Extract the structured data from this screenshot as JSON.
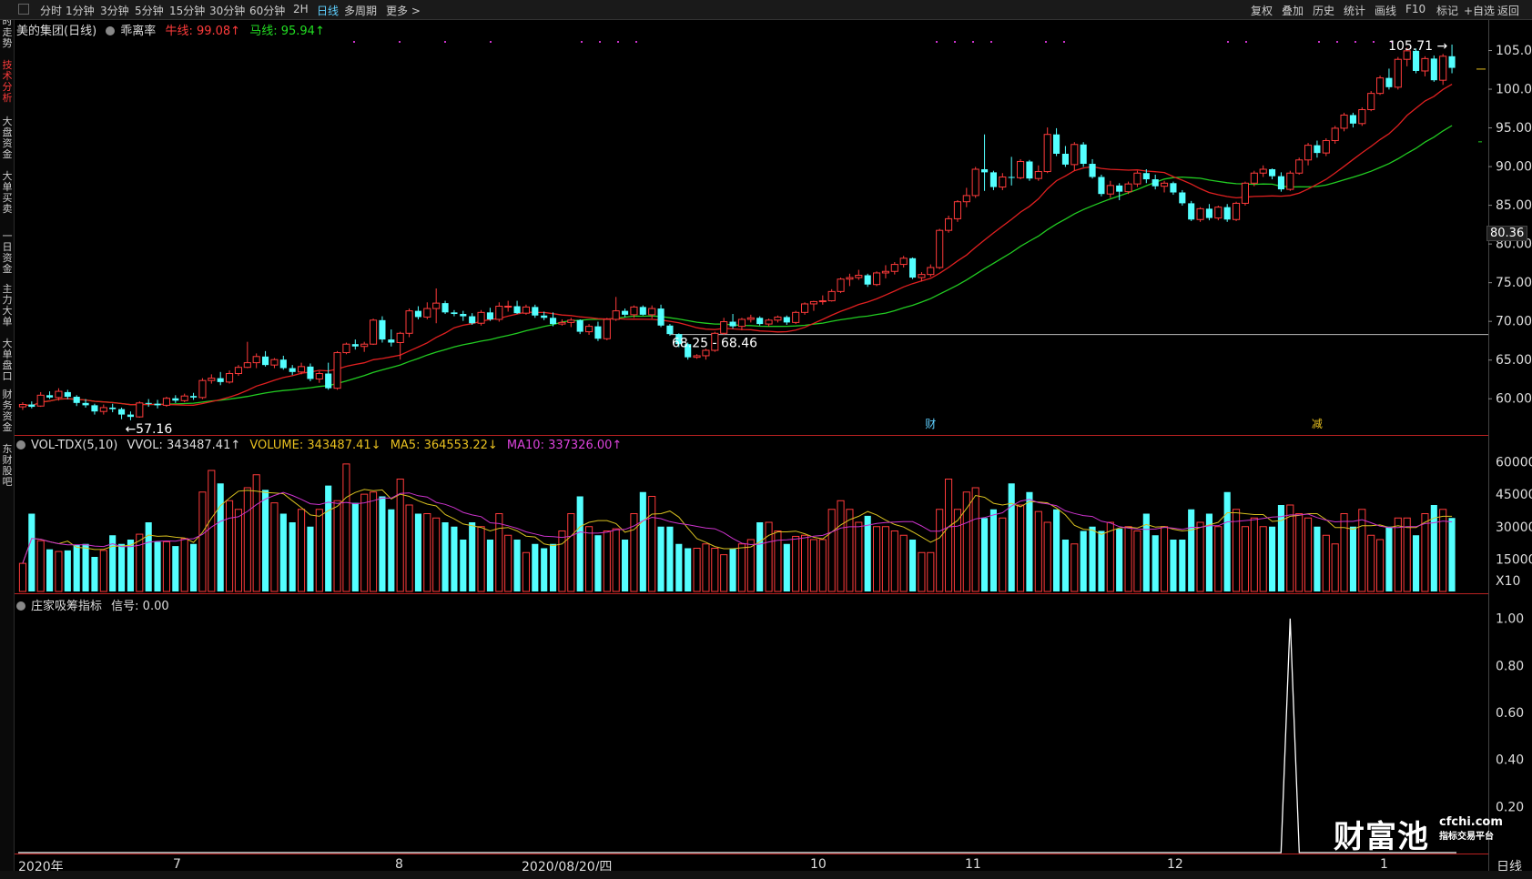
{
  "toolbar": {
    "left": [
      "分时",
      "1分钟",
      "3分钟",
      "5分钟",
      "15分钟",
      "30分钟",
      "60分钟",
      "2H",
      "日线",
      "多周期",
      "更多 >"
    ],
    "active": "日线",
    "right": [
      "复权",
      "叠加",
      "历史",
      "统计",
      "画线",
      "F10",
      "标记",
      "+自选",
      "返回"
    ]
  },
  "sidebar": [
    "分时走势",
    "技术分析",
    "大盘资金",
    "大单买卖",
    "一日资金",
    "主力大单",
    "大单盘口",
    "财务资金",
    "东财股吧"
  ],
  "sidebar_active": "技术分析",
  "price_header": {
    "stock": "美的集团(日线)",
    "indicator": "乖离率",
    "bull_label": "牛线: 99.08↑",
    "horse_label": "马线: 95.94↑"
  },
  "vol_header": {
    "name": "VOL-TDX(5,10)",
    "vvol": "VVOL: 343487.41↑",
    "volume": "VOLUME: 343487.41↓",
    "ma5": "MA5: 364553.22↓",
    "ma10": "MA10: 337326.00↑"
  },
  "sig_header": {
    "name": "庄家吸筹指标",
    "signal": "信号: 0.00"
  },
  "annotations": {
    "high": "105.71",
    "low": "57.16",
    "gap": "68.25 - 68.46",
    "marker_cai": "财",
    "marker_jian": "减",
    "current_price": "80.36",
    "vol_unit": "X10"
  },
  "dates": [
    "2020年",
    "7",
    "8",
    "2020/08/20/四",
    "10",
    "11",
    "12",
    "1"
  ],
  "period_label": "日线",
  "watermark": {
    "brand": "财富池",
    "site": "cfchi.com",
    "tagline": "指标交易平台"
  },
  "colors": {
    "up": "#ff3b3b",
    "down": "#54ffff",
    "ma_red": "#e02020",
    "ma_green": "#22cc22",
    "ma5": "#d8c020",
    "ma10": "#cc33cc"
  },
  "chart_data": [
    {
      "type": "candlestick",
      "title": "美的集团(日线)",
      "y_ticks": [
        60,
        65,
        70,
        75,
        80,
        85,
        90,
        95,
        100,
        105
      ],
      "ylim": [
        55.5,
        107
      ],
      "series_ohlc": [
        [
          58.9,
          59.5,
          58.5,
          59.2
        ],
        [
          59.2,
          59.6,
          58.7,
          58.9
        ],
        [
          59.0,
          60.8,
          58.9,
          60.4
        ],
        [
          60.4,
          60.9,
          59.9,
          60.1
        ],
        [
          60.1,
          61.3,
          59.7,
          60.9
        ],
        [
          60.8,
          61.1,
          59.9,
          60.2
        ],
        [
          60.2,
          60.4,
          59.0,
          59.4
        ],
        [
          59.4,
          59.9,
          58.8,
          59.1
        ],
        [
          59.1,
          59.3,
          57.9,
          58.3
        ],
        [
          58.3,
          59.2,
          57.9,
          58.8
        ],
        [
          58.8,
          59.3,
          58.2,
          58.6
        ],
        [
          58.6,
          58.8,
          57.3,
          57.9
        ],
        [
          57.9,
          58.3,
          57.16,
          57.6
        ],
        [
          57.6,
          59.6,
          57.5,
          59.4
        ],
        [
          59.4,
          59.9,
          58.9,
          59.3
        ],
        [
          59.3,
          59.8,
          58.7,
          59.1
        ],
        [
          59.1,
          60.2,
          58.9,
          60.0
        ],
        [
          60.0,
          60.4,
          59.4,
          59.7
        ],
        [
          59.7,
          60.6,
          59.5,
          60.3
        ],
        [
          60.3,
          60.7,
          59.8,
          60.1
        ],
        [
          60.1,
          62.6,
          59.9,
          62.3
        ],
        [
          62.3,
          63.1,
          61.9,
          62.6
        ],
        [
          62.6,
          63.4,
          61.7,
          62.1
        ],
        [
          62.1,
          63.6,
          61.9,
          63.2
        ],
        [
          63.2,
          64.3,
          62.9,
          64.0
        ],
        [
          64.0,
          67.3,
          63.9,
          64.6
        ],
        [
          64.6,
          65.8,
          63.9,
          65.4
        ],
        [
          65.4,
          66.1,
          64.1,
          64.3
        ],
        [
          64.3,
          65.2,
          63.9,
          65.0
        ],
        [
          65.0,
          65.5,
          63.7,
          63.9
        ],
        [
          63.9,
          64.3,
          63.0,
          63.4
        ],
        [
          63.4,
          64.6,
          63.1,
          64.1
        ],
        [
          64.1,
          64.5,
          62.2,
          62.5
        ],
        [
          62.5,
          63.5,
          62.0,
          63.2
        ],
        [
          63.2,
          64.6,
          61.1,
          61.3
        ],
        [
          61.3,
          66.1,
          61.1,
          65.9
        ],
        [
          65.9,
          67.2,
          65.7,
          67.0
        ],
        [
          67.0,
          67.6,
          66.3,
          66.7
        ],
        [
          66.7,
          67.3,
          66.0,
          67.0
        ],
        [
          67.0,
          70.3,
          66.9,
          70.1
        ],
        [
          70.1,
          70.6,
          67.2,
          67.6
        ],
        [
          67.6,
          68.9,
          66.7,
          67.2
        ],
        [
          67.2,
          68.6,
          65.0,
          68.4
        ],
        [
          68.4,
          71.6,
          67.9,
          71.3
        ],
        [
          71.3,
          71.9,
          70.2,
          70.5
        ],
        [
          70.5,
          72.4,
          70.2,
          71.6
        ],
        [
          71.6,
          74.2,
          69.7,
          72.3
        ],
        [
          72.3,
          72.6,
          70.9,
          71.1
        ],
        [
          71.1,
          71.4,
          70.6,
          70.9
        ],
        [
          70.9,
          71.3,
          70.0,
          70.6
        ],
        [
          70.6,
          71.0,
          69.5,
          69.7
        ],
        [
          69.7,
          71.4,
          69.4,
          71.1
        ],
        [
          71.1,
          71.7,
          70.0,
          70.2
        ],
        [
          70.2,
          72.4,
          69.9,
          71.9
        ],
        [
          71.9,
          72.6,
          71.2,
          71.9
        ],
        [
          71.9,
          72.6,
          70.9,
          71.0
        ],
        [
          71.0,
          72.1,
          70.8,
          71.8
        ],
        [
          71.8,
          72.1,
          70.4,
          70.7
        ],
        [
          70.7,
          71.2,
          70.1,
          70.4
        ],
        [
          70.4,
          71.1,
          69.3,
          69.6
        ],
        [
          69.6,
          70.2,
          69.4,
          69.8
        ],
        [
          69.8,
          70.4,
          69.2,
          70.1
        ],
        [
          70.1,
          70.2,
          68.3,
          68.6
        ],
        [
          68.6,
          69.6,
          68.2,
          69.3
        ],
        [
          69.3,
          69.9,
          67.4,
          67.7
        ],
        [
          67.7,
          70.4,
          67.5,
          70.2
        ],
        [
          70.2,
          73.1,
          70.0,
          71.3
        ],
        [
          71.3,
          71.6,
          70.5,
          70.8
        ],
        [
          70.8,
          72.0,
          70.4,
          71.8
        ],
        [
          71.8,
          72.0,
          70.7,
          70.8
        ],
        [
          70.8,
          72.0,
          70.3,
          71.6
        ],
        [
          71.6,
          72.1,
          69.2,
          69.4
        ],
        [
          69.4,
          69.6,
          68.1,
          68.3
        ],
        [
          68.3,
          68.4,
          66.6,
          67.0
        ],
        [
          67.0,
          67.2,
          65.0,
          65.3
        ],
        [
          65.3,
          65.7,
          65.1,
          65.5
        ],
        [
          65.5,
          66.4,
          65.0,
          66.2
        ],
        [
          66.2,
          68.6,
          66.0,
          68.4
        ],
        [
          68.4,
          70.4,
          68.2,
          69.9
        ],
        [
          69.9,
          70.9,
          69.0,
          69.3
        ],
        [
          69.3,
          70.4,
          68.8,
          70.2
        ],
        [
          70.2,
          70.8,
          69.8,
          70.4
        ],
        [
          70.4,
          70.6,
          69.4,
          69.6
        ],
        [
          69.6,
          70.3,
          69.3,
          70.1
        ],
        [
          70.1,
          70.7,
          69.8,
          70.5
        ],
        [
          70.5,
          70.7,
          69.5,
          69.8
        ],
        [
          69.8,
          71.3,
          69.6,
          71.1
        ],
        [
          71.1,
          72.4,
          70.8,
          72.2
        ],
        [
          72.2,
          72.6,
          71.3,
          72.5
        ],
        [
          72.5,
          73.3,
          72.1,
          72.6
        ],
        [
          72.6,
          74.1,
          72.5,
          73.8
        ],
        [
          73.8,
          75.6,
          73.6,
          75.4
        ],
        [
          75.4,
          76.1,
          74.5,
          75.6
        ],
        [
          75.6,
          76.6,
          75.3,
          75.9
        ],
        [
          75.9,
          76.1,
          74.4,
          74.7
        ],
        [
          74.7,
          76.4,
          74.5,
          76.2
        ],
        [
          76.2,
          77.2,
          75.5,
          76.4
        ],
        [
          76.4,
          77.6,
          76.0,
          77.3
        ],
        [
          77.3,
          78.4,
          76.9,
          78.1
        ],
        [
          78.1,
          78.2,
          75.4,
          75.6
        ],
        [
          75.6,
          76.3,
          75.1,
          76.0
        ],
        [
          76.0,
          77.3,
          75.7,
          76.9
        ],
        [
          76.9,
          81.9,
          76.7,
          81.7
        ],
        [
          81.7,
          83.6,
          81.4,
          83.2
        ],
        [
          83.2,
          85.6,
          82.8,
          85.4
        ],
        [
          85.4,
          87.2,
          84.7,
          86.2
        ],
        [
          86.2,
          89.9,
          85.9,
          89.6
        ],
        [
          89.6,
          94.1,
          86.8,
          89.2
        ],
        [
          89.2,
          89.4,
          86.9,
          87.3
        ],
        [
          87.3,
          89.1,
          86.9,
          88.6
        ],
        [
          88.6,
          91.2,
          87.5,
          88.5
        ],
        [
          88.5,
          90.9,
          88.3,
          90.6
        ],
        [
          90.6,
          90.8,
          88.1,
          88.4
        ],
        [
          88.4,
          90.1,
          88.1,
          89.3
        ],
        [
          89.3,
          95.0,
          89.1,
          94.1
        ],
        [
          94.1,
          94.9,
          91.3,
          91.6
        ],
        [
          91.6,
          92.6,
          89.9,
          90.2
        ],
        [
          90.2,
          93.1,
          89.4,
          92.8
        ],
        [
          92.8,
          93.1,
          89.9,
          90.3
        ],
        [
          90.3,
          90.9,
          88.4,
          88.6
        ],
        [
          88.6,
          88.9,
          86.1,
          86.4
        ],
        [
          86.4,
          88.1,
          85.9,
          87.5
        ],
        [
          87.5,
          87.8,
          85.6,
          86.7
        ],
        [
          86.7,
          88.0,
          86.4,
          87.7
        ],
        [
          87.7,
          89.4,
          87.3,
          89.1
        ],
        [
          89.1,
          89.6,
          87.8,
          88.3
        ],
        [
          88.3,
          88.9,
          87.0,
          87.4
        ],
        [
          87.4,
          88.1,
          86.6,
          87.8
        ],
        [
          87.8,
          88.0,
          86.3,
          86.6
        ],
        [
          86.6,
          86.9,
          84.9,
          85.2
        ],
        [
          85.2,
          85.5,
          82.9,
          83.1
        ],
        [
          83.1,
          84.7,
          82.8,
          84.5
        ],
        [
          84.5,
          85.1,
          83.0,
          83.3
        ],
        [
          83.3,
          84.9,
          83.0,
          84.7
        ],
        [
          84.7,
          85.1,
          82.8,
          83.1
        ],
        [
          83.1,
          85.4,
          82.9,
          85.2
        ],
        [
          85.2,
          88.0,
          84.9,
          87.8
        ],
        [
          87.8,
          89.4,
          87.4,
          89.1
        ],
        [
          89.1,
          90.1,
          88.6,
          89.6
        ],
        [
          89.6,
          89.7,
          88.3,
          88.7
        ],
        [
          88.7,
          89.2,
          86.7,
          87.0
        ],
        [
          87.0,
          89.4,
          86.8,
          89.1
        ],
        [
          89.1,
          91.1,
          88.9,
          90.8
        ],
        [
          90.8,
          93.0,
          90.1,
          92.7
        ],
        [
          92.7,
          93.3,
          91.1,
          91.7
        ],
        [
          91.7,
          93.6,
          91.3,
          93.3
        ],
        [
          93.3,
          95.2,
          92.9,
          94.9
        ],
        [
          94.9,
          96.9,
          94.5,
          96.6
        ],
        [
          96.6,
          96.9,
          95.0,
          95.5
        ],
        [
          95.5,
          97.6,
          95.2,
          97.3
        ],
        [
          97.3,
          99.7,
          97.1,
          99.4
        ],
        [
          99.4,
          101.7,
          99.2,
          101.4
        ],
        [
          101.4,
          102.6,
          99.9,
          100.2
        ],
        [
          100.2,
          104.1,
          99.9,
          103.8
        ],
        [
          103.8,
          105.3,
          102.9,
          104.9
        ],
        [
          104.9,
          105.2,
          102.0,
          102.3
        ],
        [
          102.3,
          104.2,
          101.6,
          103.9
        ],
        [
          103.9,
          104.3,
          100.9,
          101.1
        ],
        [
          101.1,
          104.5,
          100.5,
          104.2
        ],
        [
          104.2,
          105.71,
          102.0,
          102.7
        ]
      ]
    },
    {
      "type": "bar",
      "title": "VOL-TDX(5,10)",
      "y_ticks": [
        15000,
        30000,
        45000,
        60000
      ],
      "unit": "X10",
      "ylim": [
        0,
        64000
      ],
      "values": [
        13000,
        36000,
        23500,
        19500,
        18500,
        19000,
        21500,
        22000,
        16000,
        19000,
        26000,
        22000,
        24000,
        26500,
        32000,
        23000,
        23000,
        21000,
        24500,
        22000,
        46000,
        56000,
        50000,
        42000,
        38000,
        48000,
        54000,
        47000,
        41000,
        36000,
        32000,
        38000,
        30000,
        38000,
        49000,
        42000,
        59000,
        41000,
        45000,
        46000,
        44000,
        38000,
        52000,
        40000,
        36000,
        36000,
        34000,
        32000,
        30000,
        24000,
        32000,
        30000,
        24000,
        36000,
        26000,
        24000,
        18000,
        22000,
        20000,
        22000,
        28000,
        36000,
        44000,
        30000,
        26000,
        28000,
        29000,
        24000,
        36000,
        46000,
        44000,
        30000,
        30000,
        22000,
        20000,
        20000,
        22000,
        20000,
        17000,
        20000,
        22000,
        24000,
        32000,
        32000,
        28000,
        22000,
        25500,
        26000,
        24000,
        24000,
        38000,
        42000,
        38000,
        32000,
        35000,
        30000,
        30000,
        28000,
        26000,
        24000,
        18000,
        18000,
        38000,
        52000,
        38000,
        46000,
        48000,
        34000,
        38000,
        34000,
        50000,
        40000,
        46000,
        37000,
        32000,
        38000,
        24000,
        22000,
        28000,
        30000,
        28000,
        32000,
        29000,
        30000,
        28000,
        36000,
        26000,
        30000,
        24000,
        24000,
        38000,
        32000,
        36000,
        30000,
        46000,
        38000,
        30000,
        34000,
        30000,
        30000,
        40000,
        40000,
        36000,
        34000,
        30000,
        26000,
        22000,
        36000,
        30000,
        38000,
        26000,
        24000,
        30000,
        34000,
        34000,
        26000,
        36000,
        40000,
        38000,
        34000
      ]
    },
    {
      "type": "line",
      "title": "庄家吸筹指标",
      "y_ticks": [
        0.2,
        0.4,
        0.6,
        0.8,
        1.0
      ],
      "ylim": [
        0,
        1.03
      ],
      "spike_index": 141,
      "spike_value": 1.0
    }
  ]
}
